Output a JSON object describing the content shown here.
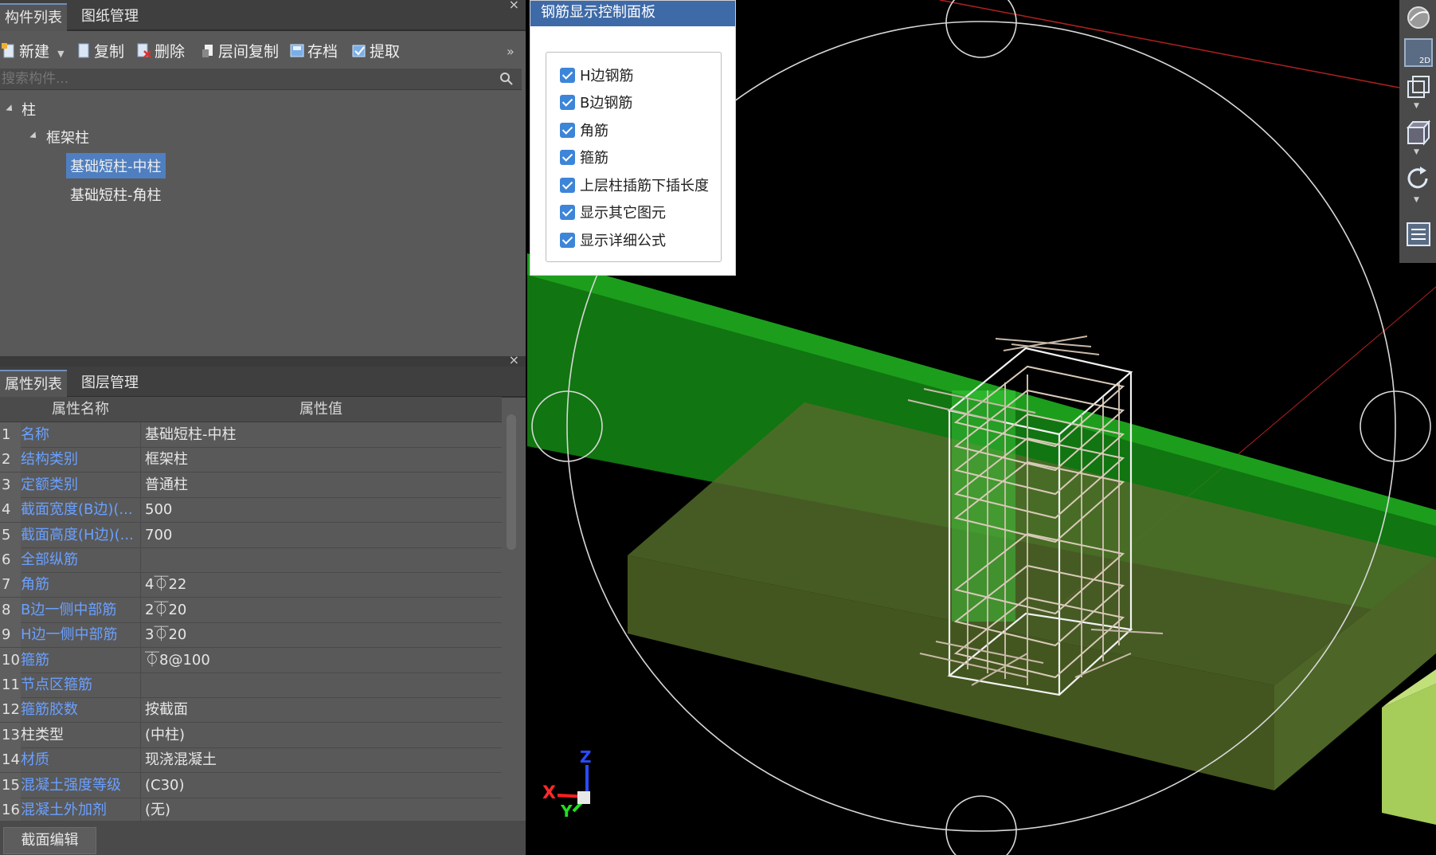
{
  "component_panel": {
    "tabs": [
      "构件列表",
      "图纸管理"
    ],
    "close": "×",
    "toolbar": {
      "new": "新建",
      "copy": "复制",
      "delete": "删除",
      "floor_copy": "层间复制",
      "save": "存档",
      "extract": "提取",
      "more": "»"
    },
    "search_placeholder": "搜索构件...",
    "tree": {
      "root": "柱",
      "child": "框架柱",
      "items": [
        "基础短柱-中柱",
        "基础短柱-角柱"
      ]
    }
  },
  "property_panel": {
    "tabs": [
      "属性列表",
      "图层管理"
    ],
    "close": "×",
    "header": {
      "name": "属性名称",
      "value": "属性值"
    },
    "rows": [
      {
        "num": "1",
        "name": "名称",
        "value": "基础短柱-中柱",
        "blue": true
      },
      {
        "num": "2",
        "name": "结构类别",
        "value": "框架柱",
        "blue": true
      },
      {
        "num": "3",
        "name": "定额类别",
        "value": "普通柱",
        "blue": true
      },
      {
        "num": "4",
        "name": "截面宽度(B边)(...",
        "value": "500",
        "blue": true
      },
      {
        "num": "5",
        "name": "截面高度(H边)(...",
        "value": "700",
        "blue": true
      },
      {
        "num": "6",
        "name": "全部纵筋",
        "value": "",
        "blue": true
      },
      {
        "num": "7",
        "name": "角筋",
        "value": "4⏁22",
        "blue": true
      },
      {
        "num": "8",
        "name": "B边一侧中部筋",
        "value": "2⏁20",
        "blue": true
      },
      {
        "num": "9",
        "name": "H边一侧中部筋",
        "value": "3⏁20",
        "blue": true
      },
      {
        "num": "10",
        "name": "箍筋",
        "value": "⏁8@100",
        "blue": true
      },
      {
        "num": "11",
        "name": "节点区箍筋",
        "value": "",
        "blue": true
      },
      {
        "num": "12",
        "name": "箍筋胶数",
        "value": "按截面",
        "blue": true
      },
      {
        "num": "13",
        "name": "柱类型",
        "value": "(中柱)",
        "blue": false
      },
      {
        "num": "14",
        "name": "材质",
        "value": "现浇混凝土",
        "blue": true
      },
      {
        "num": "15",
        "name": "混凝土强度等级",
        "value": "(C30)",
        "blue": true
      },
      {
        "num": "16",
        "name": "混凝土外加剂",
        "value": "(无)",
        "blue": true
      }
    ],
    "edit_button": "截面编辑"
  },
  "control_panel": {
    "title": "钢筋显示控制面板",
    "options": [
      {
        "label": "H边钢筋",
        "checked": true
      },
      {
        "label": "B边钢筋",
        "checked": true
      },
      {
        "label": "角筋",
        "checked": true
      },
      {
        "label": "箍筋",
        "checked": true
      },
      {
        "label": "上层柱插筋下插长度",
        "checked": true
      },
      {
        "label": "显示其它图元",
        "checked": true
      },
      {
        "label": "显示详细公式",
        "checked": true
      }
    ]
  },
  "view": {
    "axis_x": "X",
    "axis_y": "Y",
    "axis_z": "Z",
    "mode_2d": "2D"
  },
  "colors": {
    "accent": "#3e6aa8",
    "selection": "#4f7fc0",
    "link_blue": "#6aa0ff",
    "beam_green": "#1f8a1f",
    "slab_olive": "#4a5a26"
  }
}
